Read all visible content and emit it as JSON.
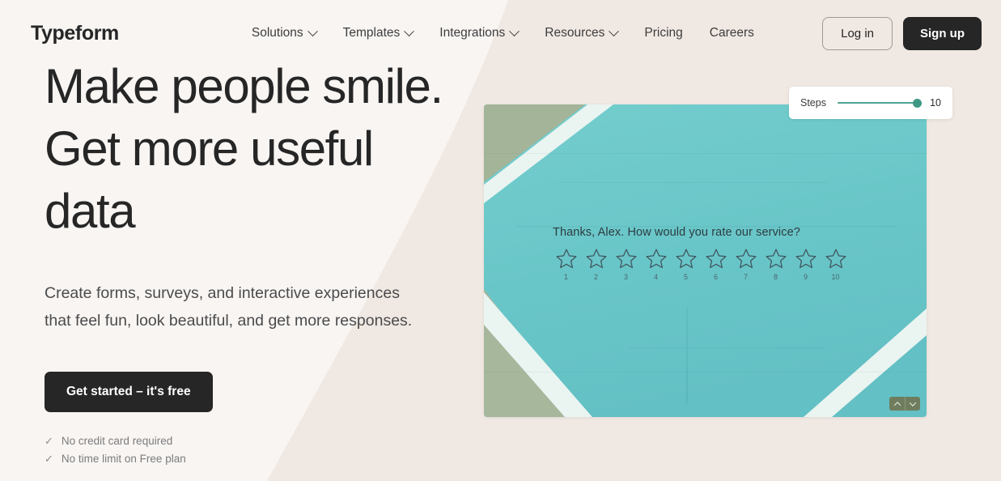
{
  "colors": {
    "bg_left": "#f8f5f2",
    "bg_right": "#f0e8e2",
    "dark": "#262627",
    "accent_teal": "#4fa392",
    "court_turquoise": "#69c7c9",
    "court_olive": "#a7b79c",
    "court_line": "#eaf4f1"
  },
  "header": {
    "logo": "Typeform",
    "nav": [
      {
        "label": "Solutions",
        "has_chevron": true,
        "icon": "chevron-down-icon"
      },
      {
        "label": "Templates",
        "has_chevron": true,
        "icon": "chevron-down-icon"
      },
      {
        "label": "Integrations",
        "has_chevron": true,
        "icon": "chevron-down-icon"
      },
      {
        "label": "Resources",
        "has_chevron": true,
        "icon": "chevron-down-icon"
      },
      {
        "label": "Pricing",
        "has_chevron": false,
        "icon": ""
      },
      {
        "label": "Careers",
        "has_chevron": false,
        "icon": ""
      }
    ],
    "login_label": "Log in",
    "signup_label": "Sign up"
  },
  "hero": {
    "headline_line1": "Make people smile.",
    "headline_line2": "Get more useful",
    "headline_line3": "data",
    "subheadline": "Create forms, surveys, and interactive experiences that feel fun, look beautiful, and get more responses.",
    "cta_label": "Get started – it's free",
    "perks": [
      {
        "tick": "✓",
        "label": "No credit card required"
      },
      {
        "tick": "✓",
        "label": "No time limit on Free plan"
      }
    ]
  },
  "steps_widget": {
    "label": "Steps",
    "value": "10",
    "slider_percent": 100
  },
  "form_preview": {
    "question": "Thanks, Alex. How would you rate our service?",
    "rating_labels": [
      "1",
      "2",
      "3",
      "4",
      "5",
      "6",
      "7",
      "8",
      "9",
      "10"
    ],
    "star_icon": "star-outline-icon",
    "nav_up_icon": "chevron-up-icon",
    "nav_down_icon": "chevron-down-icon"
  }
}
